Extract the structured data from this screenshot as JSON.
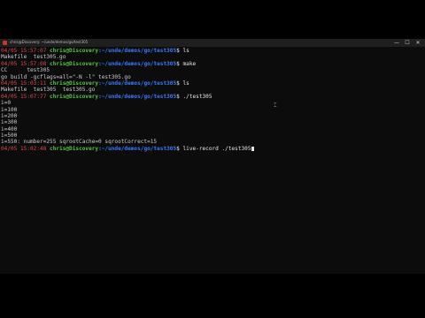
{
  "window": {
    "title": "chris@Discovery: ~/unde/demos/go/test305",
    "controls": {
      "minimize": "—",
      "maximize": "☐",
      "close": "✕"
    }
  },
  "terminal": {
    "lines": [
      {
        "kind": "prompt",
        "time": "04/05 15:57:07",
        "user": "chris@Discovery",
        "path": ":~/unde/demos/go/test305",
        "sym": "$",
        "cmd": " ls"
      },
      {
        "kind": "out",
        "text": "Makefile  test305.go"
      },
      {
        "kind": "prompt",
        "time": "04/05 15:57:08",
        "user": "chris@Discovery",
        "path": ":~/unde/demos/go/test305",
        "sym": "$",
        "cmd": " make"
      },
      {
        "kind": "out",
        "text": "CC      test305"
      },
      {
        "kind": "out",
        "text": "go build -gcflags=all=\"-N -l\" test305.go"
      },
      {
        "kind": "prompt",
        "time": "04/05 15:03:11",
        "user": "chris@Discovery",
        "path": ":~/unde/demos/go/test305",
        "sym": "$",
        "cmd": " ls"
      },
      {
        "kind": "out",
        "text": "Makefile  test305  test305.go"
      },
      {
        "kind": "prompt",
        "time": "04/05 15:07:77",
        "user": "chris@Discovery",
        "path": ":~/unde/demos/go/test305",
        "sym": "$",
        "cmd": " ./test305"
      },
      {
        "kind": "out",
        "text": "i=0"
      },
      {
        "kind": "out",
        "text": "i=100"
      },
      {
        "kind": "out",
        "text": "i=200"
      },
      {
        "kind": "out",
        "text": "i=300"
      },
      {
        "kind": "out",
        "text": "i=400"
      },
      {
        "kind": "out",
        "text": "i=500"
      },
      {
        "kind": "out",
        "text": "i=550: number=255 sqrootCache=0 sqrootCorrect=15"
      },
      {
        "kind": "prompt",
        "time": "04/05 15:02:48",
        "user": "chris@Discovery",
        "path": ":~/unde/demos/go/test305",
        "sym": "$",
        "cmd": " live-record ./test305",
        "cursor": true
      }
    ]
  },
  "colors": {
    "background": "#0c0c0c",
    "timestamp": "#d94b4b",
    "user": "#58c24a",
    "path": "#3b78ff",
    "text": "#cccccc"
  }
}
